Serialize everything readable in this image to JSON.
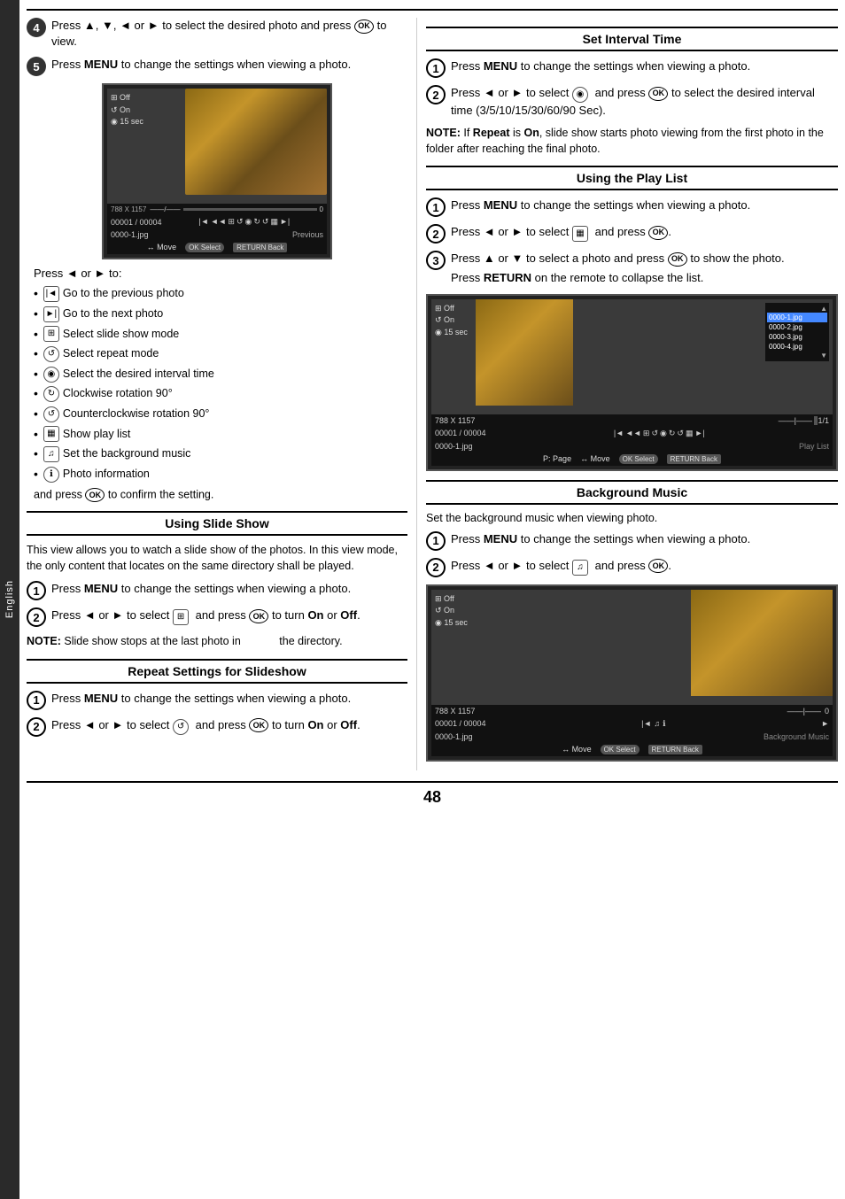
{
  "sidebar": {
    "label": "English"
  },
  "steps_top": {
    "step4": {
      "badge": "4",
      "text": "Press ▲, ▼, ◄ or ► to select the desired photo and press  to view."
    },
    "step5": {
      "badge": "5",
      "text": "Press MENU to change the settings when viewing a photo."
    }
  },
  "press_or_to": "Press ◄ or ► to:",
  "bullet_items": [
    {
      "icon": "|◄",
      "type": "box",
      "text": "Go to the previous photo"
    },
    {
      "icon": "►|",
      "type": "box",
      "text": "Go to the next photo"
    },
    {
      "icon": "⊞",
      "type": "box",
      "text": "Select slide show mode"
    },
    {
      "icon": "↺",
      "type": "circle",
      "text": "Select repeat mode"
    },
    {
      "icon": "◉",
      "type": "circle",
      "text": "Select the desired interval time"
    },
    {
      "icon": "↻",
      "type": "circle",
      "text": "Clockwise rotation 90°"
    },
    {
      "icon": "↺",
      "type": "circle",
      "text": "Counterclockwise rotation 90°"
    },
    {
      "icon": "▦",
      "type": "box",
      "text": "Show play list"
    },
    {
      "icon": "♫",
      "type": "box",
      "text": "Set the background music"
    },
    {
      "icon": "ℹ",
      "type": "circle",
      "text": "Photo information"
    }
  ],
  "confirm_line": "and press  to confirm the setting.",
  "slide_show_section": {
    "title": "Using Slide Show",
    "intro": "This view allows you to watch a slide show of the photos. In this view mode, the only content that locates on the same directory shall be played.",
    "steps": [
      {
        "badge": "1",
        "text": "Press MENU to change the settings when viewing a photo."
      },
      {
        "badge": "2",
        "text": "Press ◄ or ► to select  and press  to turn On or Off."
      }
    ],
    "note": "NOTE: Slide show stops at the last photo in the directory."
  },
  "repeat_section": {
    "title": "Repeat Settings for Slideshow",
    "steps": [
      {
        "badge": "1",
        "text": "Press MENU to change the settings when viewing a photo."
      },
      {
        "badge": "2",
        "text": "Press ◄ or ► to select  and press  to turn On or Off."
      }
    ]
  },
  "interval_section": {
    "title": "Set Interval Time",
    "steps": [
      {
        "badge": "1",
        "text": "Press MENU to change the settings when viewing a photo."
      },
      {
        "badge": "2",
        "text": "Press ◄ or ► to select  and press  to select the desired interval time (3/5/10/15/30/60/90 Sec)."
      }
    ],
    "note": "NOTE: If Repeat is On, slide show starts photo viewing from the first photo in the folder after reaching the final photo."
  },
  "playlist_section": {
    "title": "Using the Play List",
    "steps": [
      {
        "badge": "1",
        "text": "Press MENU to change the settings when viewing a photo."
      },
      {
        "badge": "2",
        "text": "Press ◄ or ► to select  and press ."
      },
      {
        "badge": "3",
        "text": "Press ▲ or ▼ to select a photo and press  to show the photo.",
        "extra": "Press RETURN on the remote to collapse the list."
      }
    ]
  },
  "bg_music_section": {
    "title": "Background Music",
    "intro": "Set the background music when viewing photo.",
    "steps": [
      {
        "badge": "1",
        "text": "Press MENU to change the settings when viewing a photo."
      },
      {
        "badge": "2",
        "text": "Press ◄ or ► to select  and press ."
      }
    ]
  },
  "tv_mockup": {
    "resolution": "788 X 1157",
    "counter": "00001 / 00004",
    "filename": "0000-1.jpg",
    "label_off": "Off",
    "label_on": "On",
    "label_15sec": "15 sec",
    "nav_label": "Previous"
  },
  "page_number": "48"
}
